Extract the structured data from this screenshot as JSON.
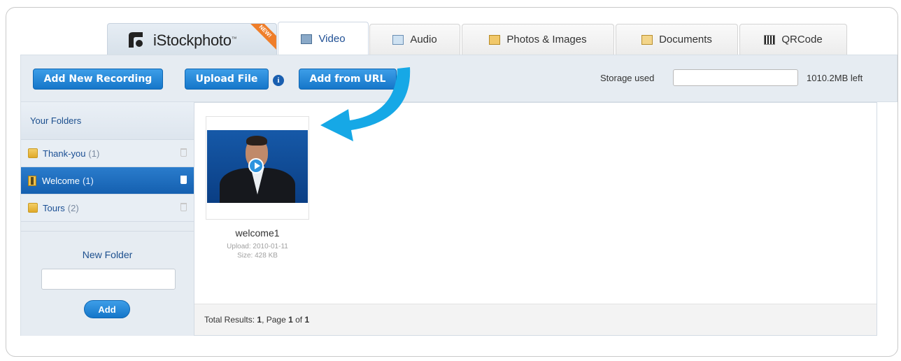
{
  "brand": {
    "name": "iStockphoto",
    "trademark": "™",
    "ribbon": "NEW!"
  },
  "tabs": [
    {
      "label": "Video",
      "icon": "film-icon",
      "active": true
    },
    {
      "label": "Audio",
      "icon": "audio-icon"
    },
    {
      "label": "Photos & Images",
      "icon": "photo-icon"
    },
    {
      "label": "Documents",
      "icon": "document-icon"
    },
    {
      "label": "QRCode",
      "icon": "qrcode-icon"
    }
  ],
  "toolbar": {
    "add_recording": "Add New Recording",
    "upload_file": "Upload File",
    "info": "i",
    "add_from_url": "Add from URL",
    "storage_label": "Storage used",
    "storage_left": "1010.2MB left"
  },
  "sidebar": {
    "heading": "Your Folders",
    "folders": [
      {
        "name": "Thank-you",
        "count": "(1)"
      },
      {
        "name": "Welcome",
        "count": "(1)",
        "active": true
      },
      {
        "name": "Tours",
        "count": "(2)"
      }
    ],
    "new_folder_label": "New Folder",
    "add_button": "Add"
  },
  "items": [
    {
      "name": "welcome1",
      "upload": "Upload: 2010-01-11",
      "size": "Size: 428 KB"
    }
  ],
  "footer": {
    "prefix": "Total Results: ",
    "total": "1",
    "page_text": ", Page ",
    "page": "1",
    "of_text": " of ",
    "pages": "1"
  },
  "colors": {
    "accent": "#1b6fc4",
    "arrow": "#16a8e6",
    "ribbon": "#ef7e2a"
  }
}
